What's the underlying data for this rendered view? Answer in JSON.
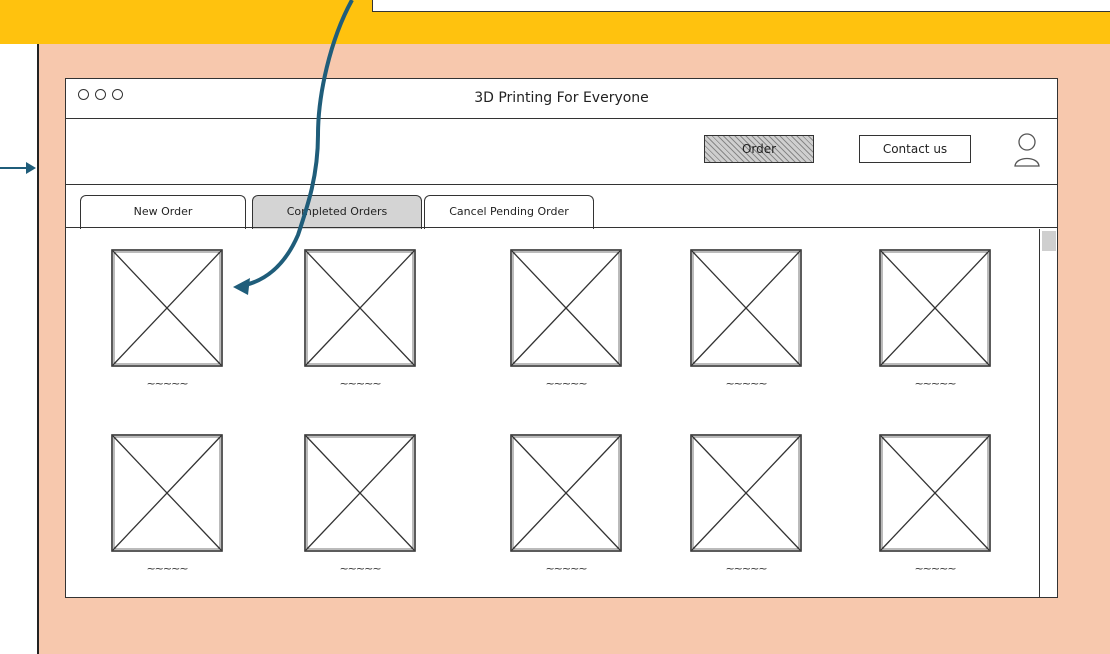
{
  "window": {
    "title": "3D Printing For Everyone"
  },
  "navbar": {
    "order_label": "Order",
    "contact_label": "Contact us"
  },
  "tabs": [
    {
      "label": "New Order"
    },
    {
      "label": "Completed Orders"
    },
    {
      "label": "Cancel Pending Order"
    }
  ],
  "grid": {
    "captions": [
      "~~~~~",
      "~~~~~",
      "~~~~~",
      "~~~~~",
      "~~~~~",
      "~~~~~",
      "~~~~~",
      "~~~~~",
      "~~~~~",
      "~~~~~"
    ]
  },
  "colors": {
    "top_strip": "#ffc20e",
    "background": "#f7c8ad",
    "arrow": "#1f5d7a",
    "active_tab": "#d4d4d4"
  }
}
